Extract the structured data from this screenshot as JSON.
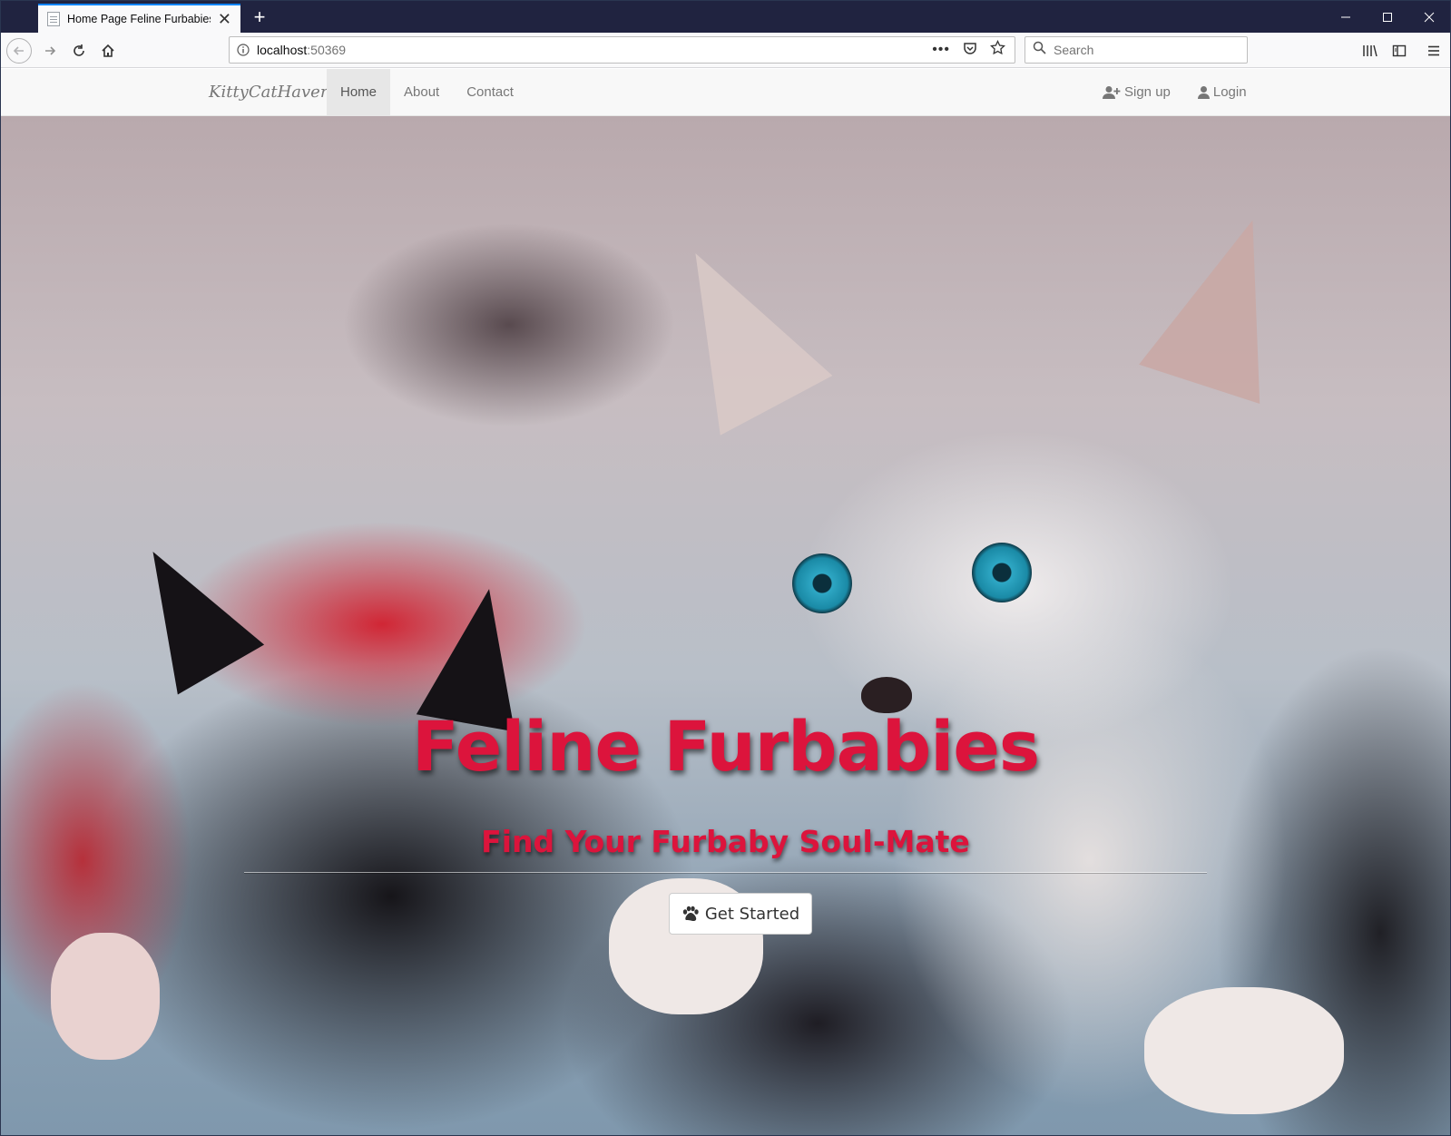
{
  "browser": {
    "tab_title": "Home Page Feline Furbabies",
    "new_tab_label": "+",
    "url_host": "localhost",
    "url_port": ":50369",
    "search_placeholder": "Search"
  },
  "site": {
    "brand": "KittyCatHaven",
    "nav": {
      "home": "Home",
      "about": "About",
      "contact": "Contact",
      "signup": "Sign up",
      "login": "Login"
    },
    "active_nav": "home"
  },
  "hero": {
    "title": "Feline Furbabies",
    "subtitle": "Find Your Furbaby Soul-Mate",
    "cta_label": "Get Started",
    "cta_icon": "paw-icon",
    "title_color": "#dc143c"
  },
  "colors": {
    "titlebar": "#202340",
    "accent": "#0a84ff"
  }
}
